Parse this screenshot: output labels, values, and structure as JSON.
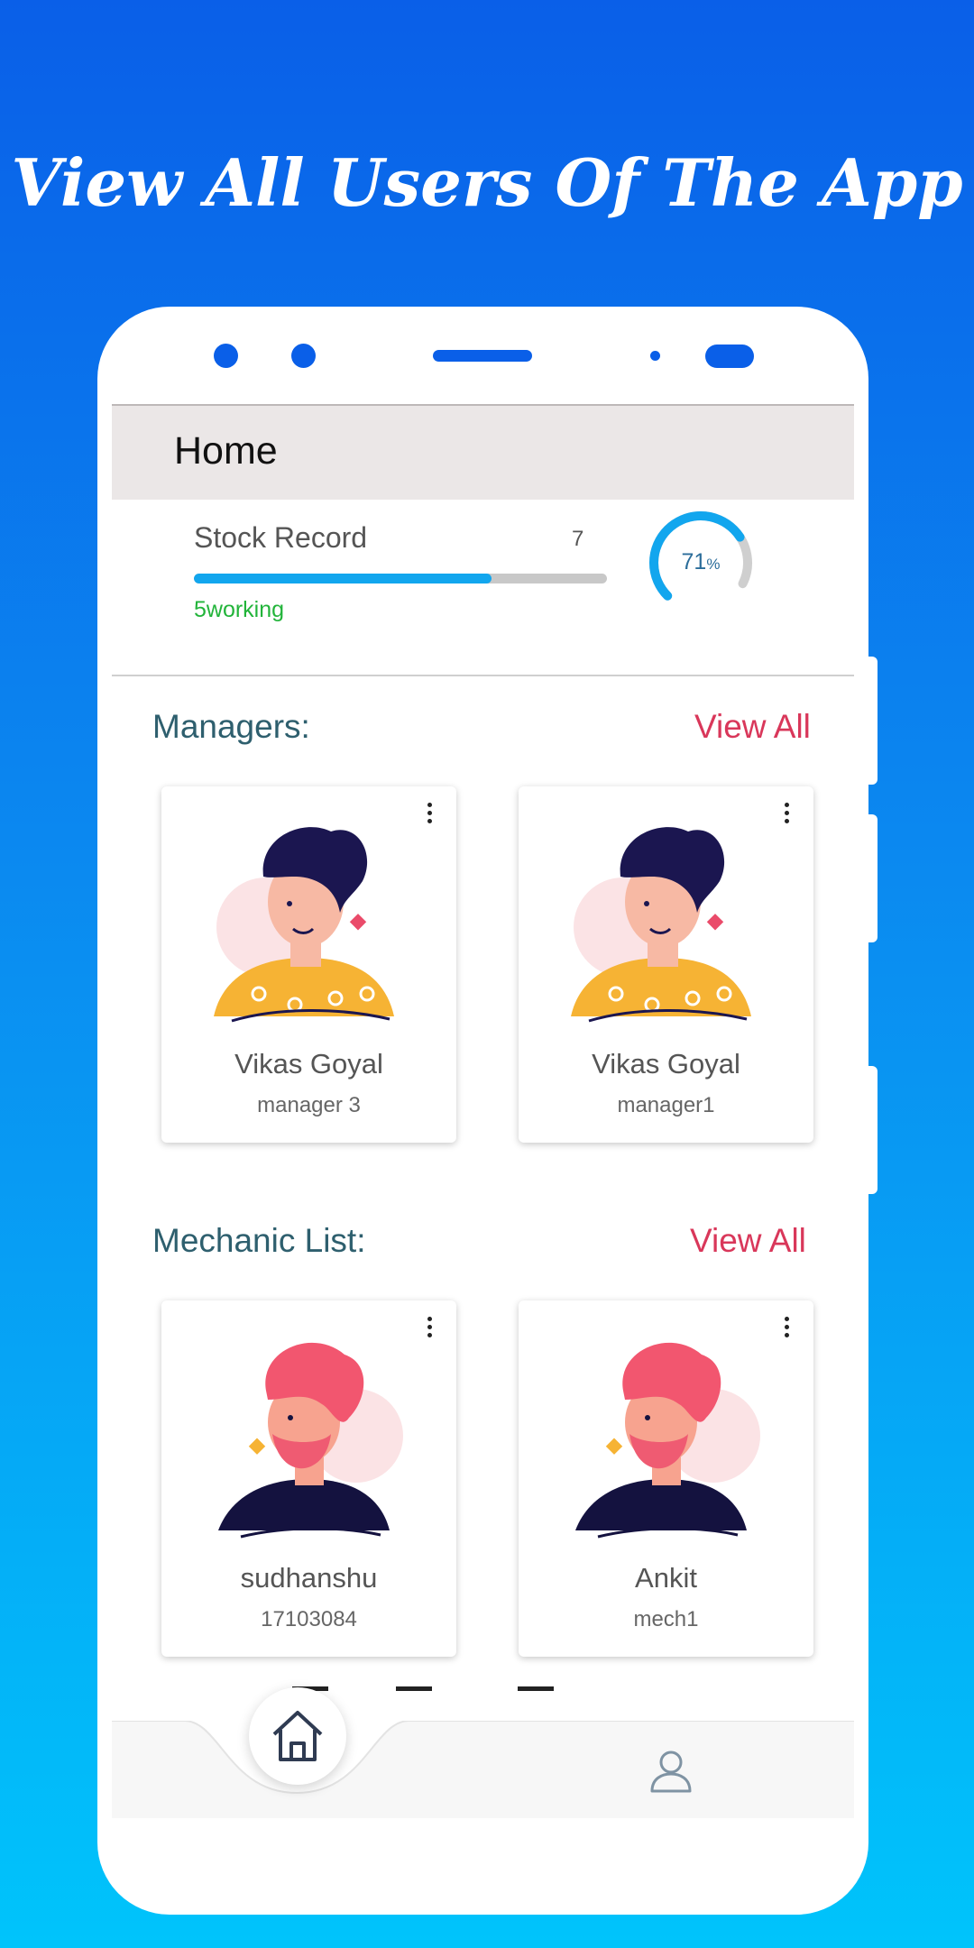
{
  "headline": "View All Users Of The App",
  "appbar": {
    "title": "Home"
  },
  "stock": {
    "label": "Stock Record",
    "count": "7",
    "status": "5working",
    "progress_fraction": 0.72,
    "gauge_percent": "71",
    "gauge_suffix": "%",
    "gauge_value": 71
  },
  "sections": {
    "managers": {
      "title": "Managers:",
      "view_all": "View All",
      "cards": [
        {
          "name": "Vikas Goyal",
          "role": "manager 3"
        },
        {
          "name": "Vikas Goyal",
          "role": "manager1"
        }
      ]
    },
    "mechanics": {
      "title": "Mechanic List:",
      "view_all": "View All",
      "cards": [
        {
          "name": "sudhanshu",
          "role": "17103084"
        },
        {
          "name": "Ankit",
          "role": "mech1"
        }
      ]
    }
  },
  "colors": {
    "accent": "#0a5fe8",
    "progress": "#12a6ee",
    "status_green": "#22b43a",
    "view_all": "#d9375a",
    "section_title": "#2e5f6e"
  },
  "icons": {
    "home": "home-icon",
    "profile": "person-icon",
    "more": "more-vert-icon"
  }
}
